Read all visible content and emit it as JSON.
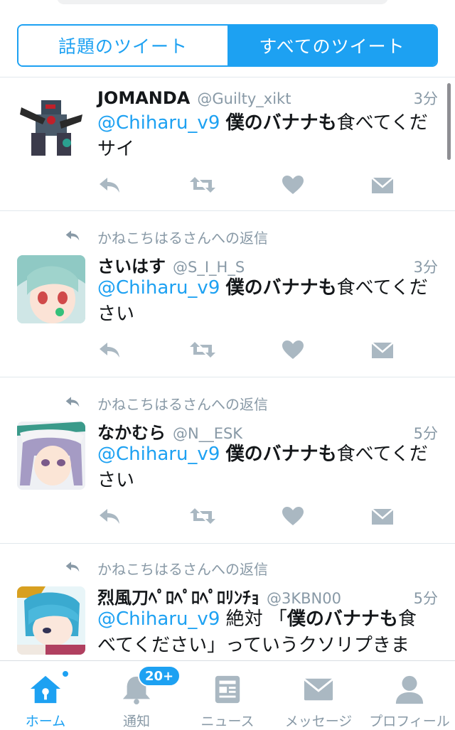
{
  "segmented": {
    "top_tweets": "話題のツイート",
    "all_tweets": "すべてのツイート"
  },
  "colors": {
    "accent": "#1da1f2",
    "muted": "#8899a6",
    "action_icon": "#aab8c2"
  },
  "tweets": [
    {
      "context": "",
      "name": "JOMANDA",
      "handle": "@Guilty_xikt",
      "time": "3分",
      "mention": "@Chiharu_v9",
      "body_bold": "僕のバナナも",
      "body_rest": "食べてくだサイ"
    },
    {
      "context": "かねこちはるさんへの返信",
      "name": "さいはす",
      "handle": "@S_I_H_S",
      "time": "3分",
      "mention": "@Chiharu_v9",
      "body_bold": "僕のバナナも",
      "body_rest": "食べてください"
    },
    {
      "context": "かねこちはるさんへの返信",
      "name": "なかむら",
      "handle": "@N__ESK",
      "time": "5分",
      "mention": "@Chiharu_v9",
      "body_bold": "僕のバナナも",
      "body_rest": "食べてください"
    },
    {
      "context": "かねこちはるさんへの返信",
      "name": "烈風刀ﾍﾟﾛﾍﾟﾛﾍﾟﾛﾘﾝﾁｮ",
      "handle": "@3KBN00",
      "time": "5分",
      "mention": "@Chiharu_v9",
      "body_pre": "絶対 「",
      "body_bold": "僕のバナナも",
      "body_rest": "食べてください」っていうクソリプきま"
    }
  ],
  "tabbar": {
    "home": "ホーム",
    "notifications": "通知",
    "notifications_badge": "20+",
    "news": "ニュース",
    "messages": "メッセージ",
    "profile": "プロフィール"
  },
  "icons": [
    "reply-icon",
    "retweet-icon",
    "like-icon",
    "dm-icon",
    "home-icon",
    "bell-icon",
    "news-icon",
    "envelope-icon",
    "person-icon"
  ]
}
